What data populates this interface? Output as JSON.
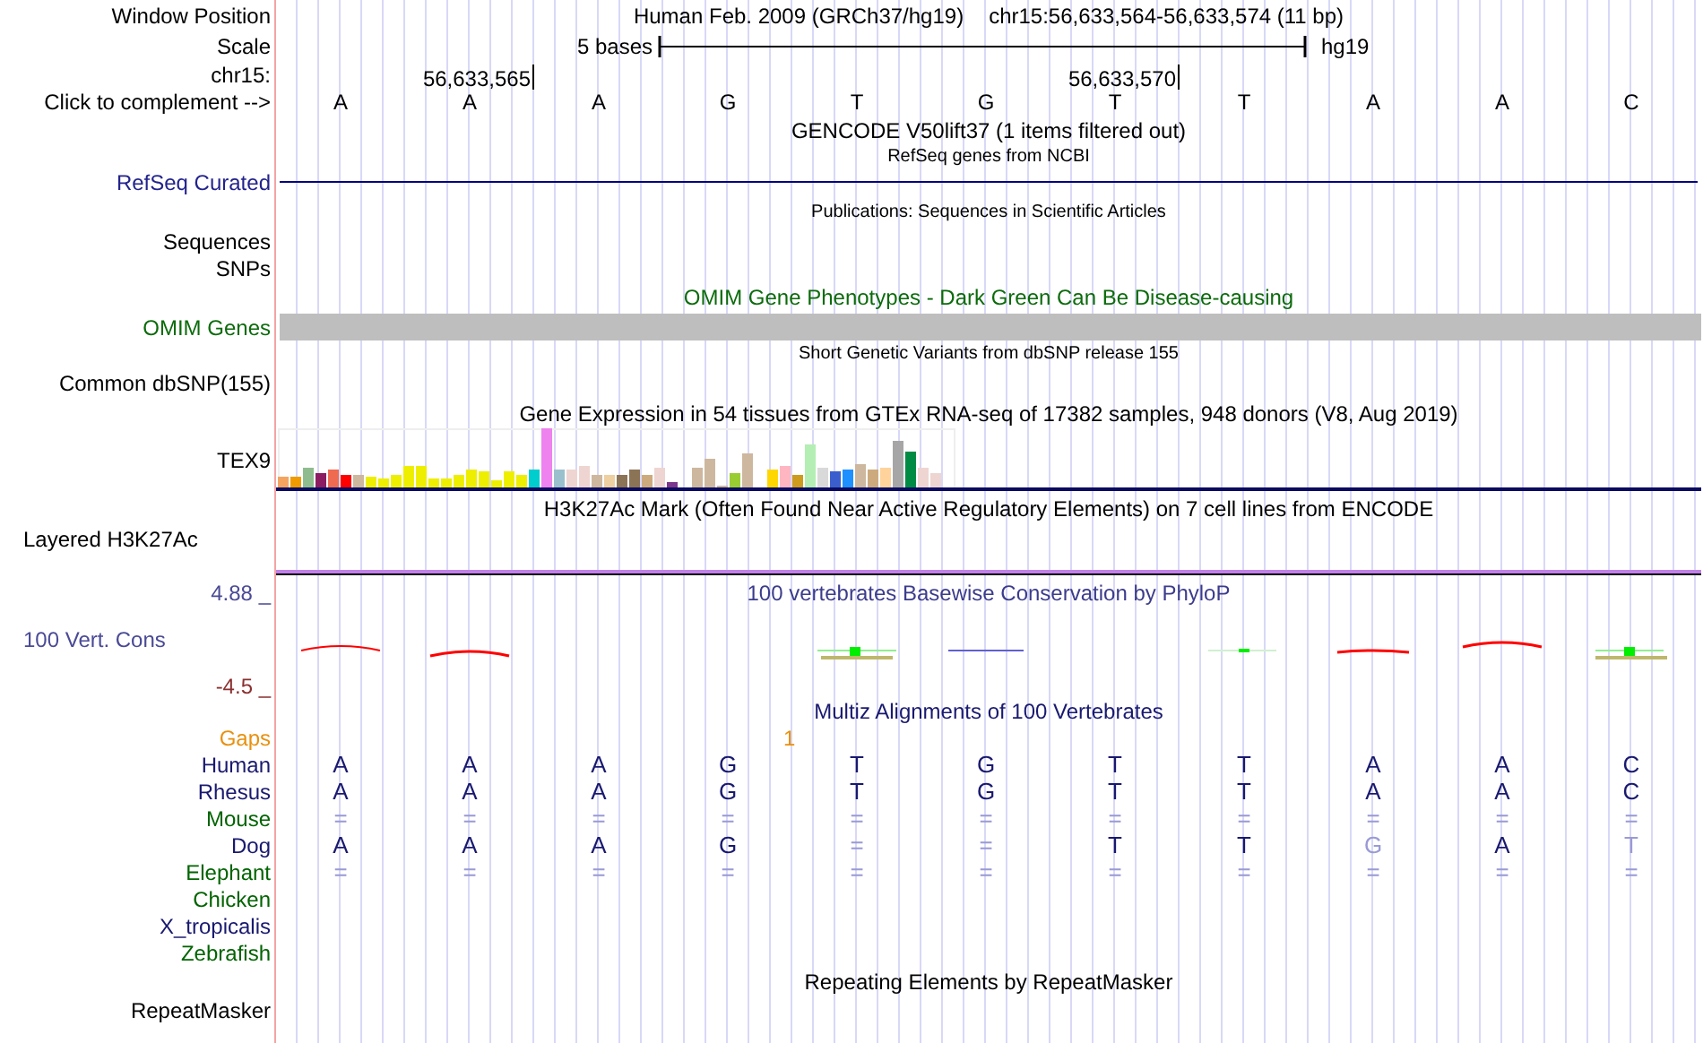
{
  "position_bar": {
    "label": "Window Position",
    "assembly": "Human Feb. 2009 (GRCh37/hg19)",
    "range": "chr15:56,633,564-56,633,574 (11 bp)"
  },
  "scale": {
    "label": "Scale",
    "length": "5 bases",
    "assembly": "hg19"
  },
  "coordinates": {
    "label": "chr15:",
    "ticks": [
      "56,633,565",
      "56,633,570"
    ]
  },
  "sequence": {
    "label": "Click to complement -->",
    "bases": [
      "A",
      "A",
      "A",
      "G",
      "T",
      "G",
      "T",
      "T",
      "A",
      "A",
      "C"
    ]
  },
  "gencode": {
    "title": "GENCODE V50lift37 (1 items filtered out)"
  },
  "refseq": {
    "title": "RefSeq genes from NCBI",
    "label": "RefSeq Curated"
  },
  "publications": {
    "title": "Publications: Sequences in Scientific Articles",
    "labels": [
      "Sequences",
      "SNPs"
    ]
  },
  "omim": {
    "title": "OMIM Gene Phenotypes - Dark Green Can Be Disease-causing",
    "label": "OMIM Genes"
  },
  "dbsnp": {
    "title": "Short Genetic Variants from dbSNP release 155",
    "label": "Common dbSNP(155)"
  },
  "gtex": {
    "title": "Gene Expression in 54 tissues from GTEx RNA-seq of 17382 samples, 948 donors (V8, Aug 2019)",
    "label": "TEX9"
  },
  "h3k27ac": {
    "title": "H3K27Ac Mark (Often Found Near Active Regulatory Elements) on 7 cell lines from ENCODE",
    "label": "Layered H3K27Ac"
  },
  "phylop": {
    "title": "100 vertebrates Basewise Conservation by PhyloP",
    "label": "100 Vert. Cons",
    "max": "4.88 _",
    "min": "-4.5 _"
  },
  "multiz": {
    "title": "Multiz Alignments of 100 Vertebrates",
    "gaps_label": "Gaps",
    "gap_count": "1",
    "species": [
      {
        "name": "Human",
        "color": "#191970",
        "bases": [
          {
            "text": "A",
            "faint": false
          },
          {
            "text": "A",
            "faint": false
          },
          {
            "text": "A",
            "faint": false
          },
          {
            "text": "G",
            "faint": false
          },
          {
            "text": "T",
            "faint": false
          },
          {
            "text": "G",
            "faint": false
          },
          {
            "text": "T",
            "faint": false
          },
          {
            "text": "T",
            "faint": false
          },
          {
            "text": "A",
            "faint": false
          },
          {
            "text": "A",
            "faint": false
          },
          {
            "text": "C",
            "faint": false
          }
        ]
      },
      {
        "name": "Rhesus",
        "color": "#191970",
        "bases": [
          {
            "text": "A",
            "faint": false
          },
          {
            "text": "A",
            "faint": false
          },
          {
            "text": "A",
            "faint": false
          },
          {
            "text": "G",
            "faint": false
          },
          {
            "text": "T",
            "faint": false
          },
          {
            "text": "G",
            "faint": false
          },
          {
            "text": "T",
            "faint": false
          },
          {
            "text": "T",
            "faint": false
          },
          {
            "text": "A",
            "faint": false
          },
          {
            "text": "A",
            "faint": false
          },
          {
            "text": "C",
            "faint": false
          }
        ]
      },
      {
        "name": "Mouse",
        "color": "#006400",
        "bases": [
          {
            "text": "=",
            "faint": true
          },
          {
            "text": "=",
            "faint": true
          },
          {
            "text": "=",
            "faint": true
          },
          {
            "text": "=",
            "faint": true
          },
          {
            "text": "=",
            "faint": true
          },
          {
            "text": "=",
            "faint": true
          },
          {
            "text": "=",
            "faint": true
          },
          {
            "text": "=",
            "faint": true
          },
          {
            "text": "=",
            "faint": true
          },
          {
            "text": "=",
            "faint": true
          },
          {
            "text": "=",
            "faint": true
          }
        ]
      },
      {
        "name": "Dog",
        "color": "#191970",
        "bases": [
          {
            "text": "A",
            "faint": false
          },
          {
            "text": "A",
            "faint": false
          },
          {
            "text": "A",
            "faint": false
          },
          {
            "text": "G",
            "faint": false
          },
          {
            "text": "=",
            "faint": true
          },
          {
            "text": "=",
            "faint": true
          },
          {
            "text": "T",
            "faint": false
          },
          {
            "text": "T",
            "faint": false
          },
          {
            "text": "G",
            "faint": true
          },
          {
            "text": "A",
            "faint": false
          },
          {
            "text": "T",
            "faint": true
          }
        ]
      },
      {
        "name": "Elephant",
        "color": "#006400",
        "bases": [
          {
            "text": "=",
            "faint": true
          },
          {
            "text": "=",
            "faint": true
          },
          {
            "text": "=",
            "faint": true
          },
          {
            "text": "=",
            "faint": true
          },
          {
            "text": "=",
            "faint": true
          },
          {
            "text": "=",
            "faint": true
          },
          {
            "text": "=",
            "faint": true
          },
          {
            "text": "=",
            "faint": true
          },
          {
            "text": "=",
            "faint": true
          },
          {
            "text": "=",
            "faint": true
          },
          {
            "text": "=",
            "faint": true
          }
        ]
      },
      {
        "name": "Chicken",
        "color": "#006400"
      },
      {
        "name": "X_tropicalis",
        "color": "#191970"
      },
      {
        "name": "Zebrafish",
        "color": "#006400"
      }
    ]
  },
  "repeatmasker": {
    "title": "Repeating Elements by RepeatMasker",
    "label": "RepeatMasker"
  }
}
